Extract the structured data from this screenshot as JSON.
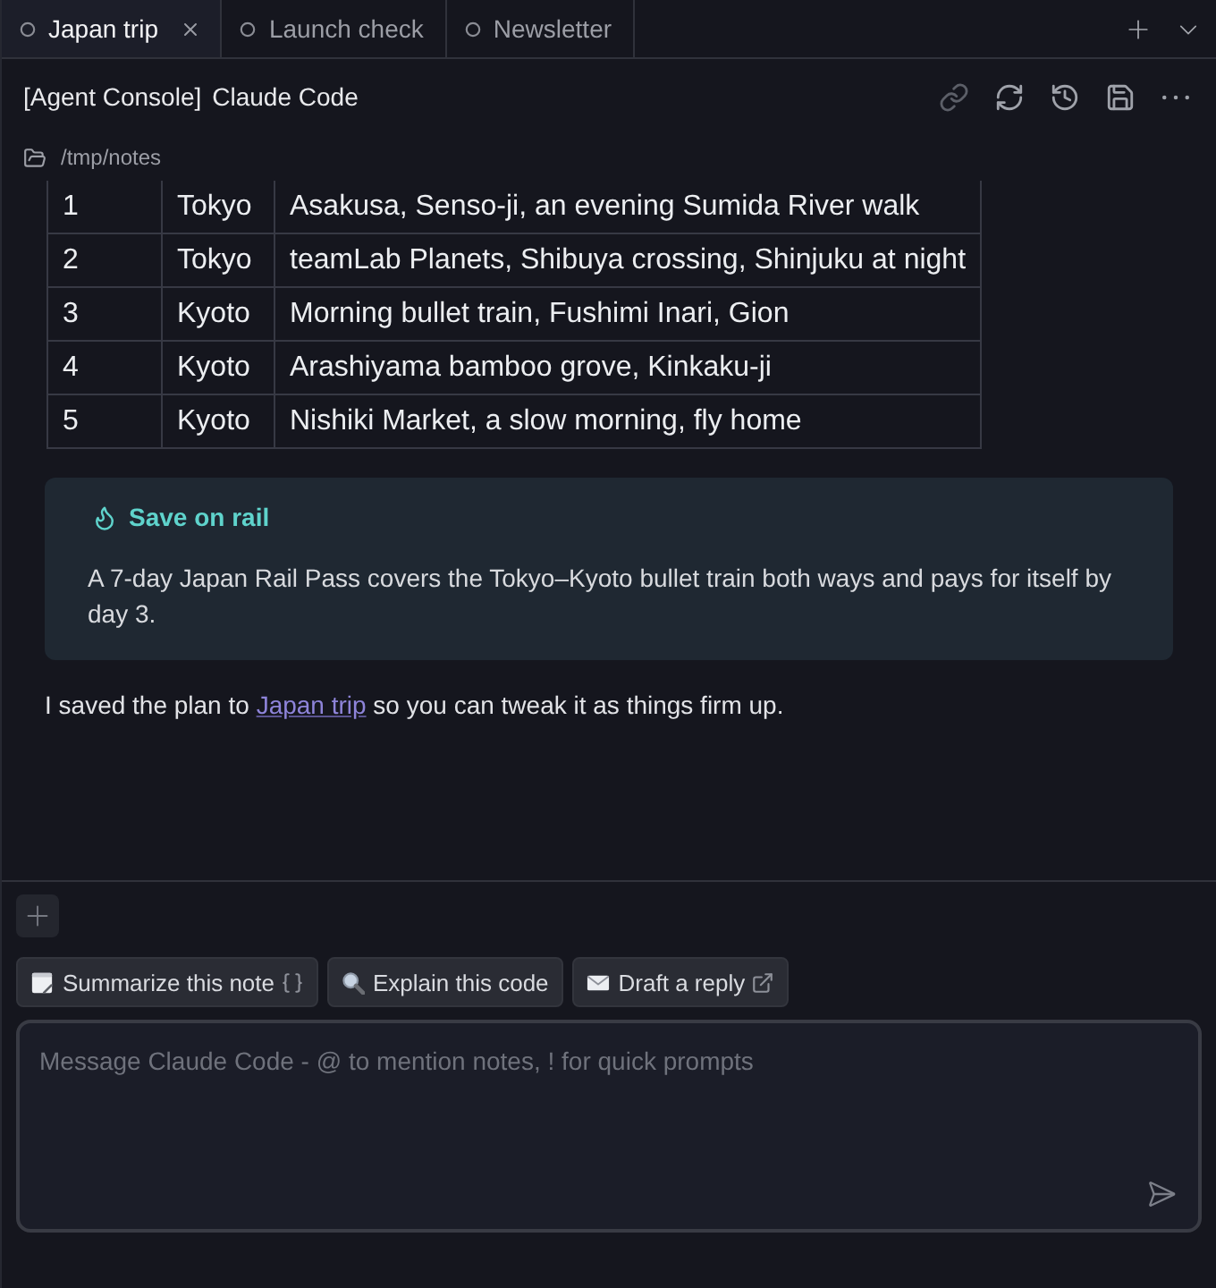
{
  "tabs": [
    {
      "label": "Japan trip",
      "selected": true
    },
    {
      "label": "Launch check",
      "selected": false
    },
    {
      "label": "Newsletter",
      "selected": false
    }
  ],
  "header": {
    "tag": "[Agent Console]",
    "title": "Claude Code"
  },
  "path": "/tmp/notes",
  "table": {
    "rows": [
      [
        "1",
        "Tokyo",
        "Asakusa, Senso-ji, an evening Sumida River walk"
      ],
      [
        "2",
        "Tokyo",
        "teamLab Planets, Shibuya crossing, Shinjuku at night"
      ],
      [
        "3",
        "Kyoto",
        "Morning bullet train, Fushimi Inari, Gion"
      ],
      [
        "4",
        "Kyoto",
        "Arashiyama bamboo grove, Kinkaku-ji"
      ],
      [
        "5",
        "Kyoto",
        "Nishiki Market, a slow morning, fly home"
      ]
    ]
  },
  "callout": {
    "title": "Save on rail",
    "body": "A 7-day Japan Rail Pass covers the Tokyo–Kyoto bullet train both ways and pays for itself by day 3."
  },
  "message": {
    "before": "I saved the plan to ",
    "link": "Japan trip",
    "after": " so you can tweak it as things firm up."
  },
  "quick_prompts": [
    {
      "kind": "note",
      "label": "Summarize this note"
    },
    {
      "kind": "search",
      "label": "Explain this code"
    },
    {
      "kind": "mail",
      "label": "Draft a reply"
    }
  ],
  "composer": {
    "placeholder": "Message Claude Code - @ to mention notes, ! for quick prompts"
  }
}
